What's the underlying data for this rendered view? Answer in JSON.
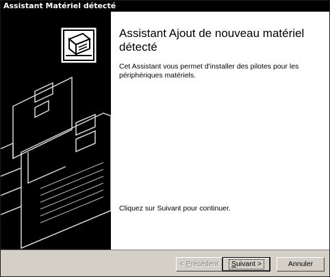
{
  "window": {
    "title": "Assistant Matériel détecté"
  },
  "content": {
    "title": "Assistant Ajout de nouveau matériel détecté",
    "description": "Cet Assistant vous permet d'installer des pilotes pour les périphériques matériels.",
    "continue_text": "Cliquez sur Suivant pour continuer."
  },
  "buttons": {
    "back_prefix": "< ",
    "back_mnemonic": "P",
    "back_rest": "récédent",
    "next_mnemonic": "S",
    "next_rest": "uivant >",
    "cancel": "Annuler",
    "back_enabled": false
  },
  "icons": {
    "hardware_wizard": "hardware-card-icon"
  },
  "colors": {
    "title_bar": "#000000",
    "side_panel": "#000000",
    "button_face": "#d4d0c8",
    "disabled_text": "#808080"
  }
}
